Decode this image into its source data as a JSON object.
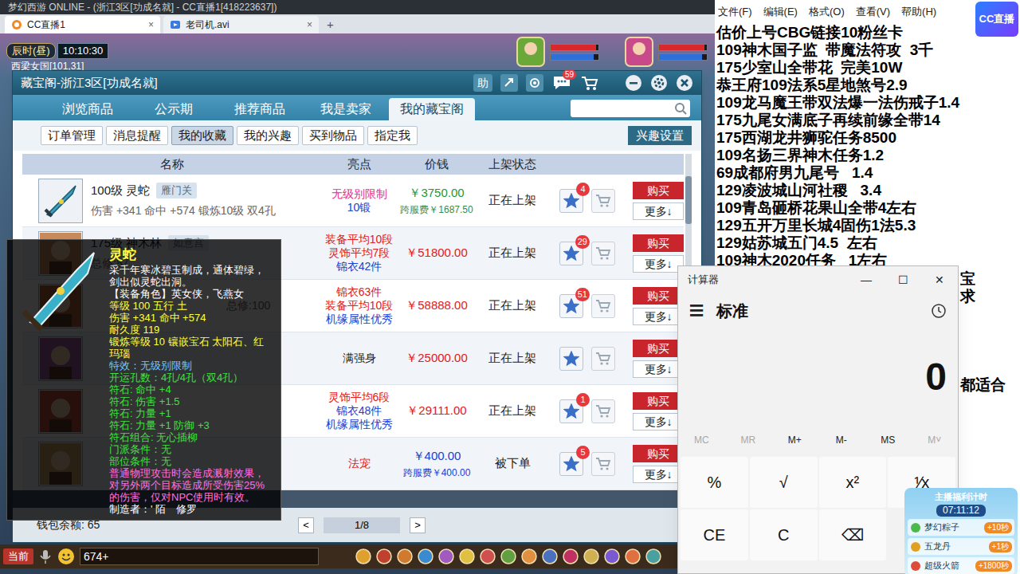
{
  "browser": {
    "title": "梦幻西游 ONLINE - (浙江3区[功成名就] - CC直播1[418223637])",
    "tabs": [
      {
        "label": "CC直播1",
        "selected": true,
        "close": "×"
      },
      {
        "label": "老司机.avi",
        "selected": false,
        "close": "×"
      }
    ],
    "new_tab": "+"
  },
  "hud": {
    "period": "辰时(昼)",
    "clock": "10:10:30",
    "location": "西梁女国[101,31]",
    "status_bars": [
      {
        "level": 0.95,
        "color": "#d8282c"
      },
      {
        "level": 0.9,
        "color": "#2f6fd8"
      },
      {
        "level": 0.95,
        "color": "#d8282c"
      },
      {
        "level": 0.9,
        "color": "#2f6fd8"
      }
    ]
  },
  "cbg": {
    "title": "藏宝阁-浙江3区[功成名就]",
    "help": "助",
    "message_badge": "59",
    "nav": [
      {
        "label": "浏览商品",
        "selected": false
      },
      {
        "label": "公示期",
        "selected": false
      },
      {
        "label": "推荐商品",
        "selected": false
      },
      {
        "label": "我是卖家",
        "selected": false
      },
      {
        "label": "我的藏宝阁",
        "selected": true
      }
    ],
    "subtabs": [
      {
        "label": "订单管理",
        "selected": false
      },
      {
        "label": "消息提醒",
        "selected": false
      },
      {
        "label": "我的收藏",
        "selected": true
      },
      {
        "label": "我的兴趣",
        "selected": false
      },
      {
        "label": "买到物品",
        "selected": false
      },
      {
        "label": "指定我",
        "selected": false
      }
    ],
    "interest_button": "兴趣设置",
    "columns": [
      "名称",
      "亮点",
      "价钱",
      "上架状态"
    ],
    "rows": [
      {
        "avatar_kind": "weapon",
        "name": "100级 灵蛇",
        "tag": "雁门关",
        "summary": "伤害 +341 命中 +574 锻炼10级 双4孔",
        "highlights": [
          {
            "text": "无级别限制",
            "color": "#e2308a"
          },
          {
            "text": "10锻",
            "color": "#2040d0"
          }
        ],
        "price": "￥3750.00",
        "price_color": "#1a9a3a",
        "fee": "跨服费￥1687.50",
        "fee_color": "#3a8a4a",
        "status": "正在上架",
        "favorites": "4",
        "favorited": true,
        "buy": "购买",
        "more": "更多↓"
      },
      {
        "avatar_kind": "character",
        "avatar_color": "#c98a5a",
        "name": "175级 神木林",
        "tag": "如意宫",
        "summary": "总修:87",
        "highlights": [
          {
            "text": "装备平均10段",
            "color": "#e02020"
          },
          {
            "text": "灵饰平均7段",
            "color": "#e02020"
          },
          {
            "text": "锦衣42件",
            "color": "#2040d0"
          }
        ],
        "price": "￥51800.00",
        "price_color": "#e02020",
        "status": "正在上架",
        "favorites": "29",
        "favorited": true,
        "buy": "购买",
        "more": "更多↓"
      },
      {
        "avatar_kind": "character",
        "avatar_color": "#b0603a",
        "summary": "总修:100",
        "highlights": [
          {
            "text": "锦衣63件",
            "color": "#e02020"
          },
          {
            "text": "装备平均10段",
            "color": "#e02020"
          },
          {
            "text": "机缘属性优秀",
            "color": "#2040d0"
          }
        ],
        "price": "￥58888.00",
        "price_color": "#e02020",
        "status": "正在上架",
        "favorites": "51",
        "favorited": true,
        "buy": "购买",
        "more": "更多↓"
      },
      {
        "avatar_kind": "character",
        "avatar_color": "#a05aa0",
        "highlights": [
          {
            "text": "满强身",
            "color": "#222222"
          }
        ],
        "price": "￥25000.00",
        "price_color": "#e02020",
        "status": "正在上架",
        "favorited": true,
        "buy": "购买",
        "more": "更多↓"
      },
      {
        "avatar_kind": "character",
        "avatar_color": "#c0503a",
        "highlights": [
          {
            "text": "灵饰平均6段",
            "color": "#e02020"
          },
          {
            "text": "锦衣48件",
            "color": "#2040d0"
          },
          {
            "text": "机缘属性优秀",
            "color": "#2040d0"
          }
        ],
        "price": "￥29111.00",
        "price_color": "#e02020",
        "status": "正在上架",
        "favorites": "1",
        "favorited": true,
        "buy": "购买",
        "more": "更多↓"
      },
      {
        "avatar_kind": "character",
        "avatar_color": "#c8a060",
        "highlights": [
          {
            "text": "法宠",
            "color": "#e02020"
          }
        ],
        "price": "￥400.00",
        "price_color": "#2040d0",
        "fee": "跨服费￥400.00",
        "fee_color": "#2040d0",
        "status": "被下单",
        "favorites": "5",
        "favorited": true,
        "buy": "购买",
        "more": "更多↓"
      }
    ],
    "pager": {
      "prev": "<",
      "page": "1/8",
      "next": ">"
    },
    "wallet": "钱包余额: 65"
  },
  "tooltip": {
    "title": "灵蛇",
    "lines": [
      {
        "text": "采千年寒冰碧玉制成，通体碧绿，剑出似灵蛇出洞。",
        "color": "#ffffff"
      },
      {
        "text": "【装备角色】英女侠，飞燕女",
        "color": "#ffffff"
      },
      {
        "text": "等级 100  五行 土",
        "color": "#ffff40"
      },
      {
        "text": "伤害 +341 命中 +574",
        "color": "#ffff40"
      },
      {
        "text": "耐久度 119",
        "color": "#ffff40"
      },
      {
        "text": "锻炼等级 10  镶嵌宝石 太阳石、红玛瑙",
        "color": "#ffff40"
      },
      {
        "text": "特效：无级别限制",
        "color": "#6ec8ff"
      },
      {
        "text": "开运孔数：4孔/4孔（双4孔）",
        "color": "#40e040"
      },
      {
        "text": "符石: 命中 +4",
        "color": "#40e040"
      },
      {
        "text": "符石: 伤害 +1.5",
        "color": "#40e040"
      },
      {
        "text": "符石: 力量 +1",
        "color": "#40e040"
      },
      {
        "text": "符石: 力量 +1 防御 +3",
        "color": "#40e040"
      },
      {
        "text": "符石组合: 无心插柳",
        "color": "#40e040"
      },
      {
        "text": "门派条件：无",
        "color": "#40e040"
      },
      {
        "text": "部位条件：无",
        "color": "#40e040"
      },
      {
        "text": "普通物理攻击时会造成溅射效果，对另外两个目标造成所受伤害25%的伤害，仅对NPC使用时有效。",
        "color": "#ff70e0"
      },
      {
        "text": "制造者：' 陌ゞ修罗",
        "color": "#ffffff"
      }
    ]
  },
  "chat": {
    "channel": "当前",
    "input": "674+"
  },
  "notepad": {
    "menu": [
      "文件(F)",
      "编辑(E)",
      "格式(O)",
      "查看(V)",
      "帮助(H)"
    ],
    "lines": [
      "估价上号CBG链接10粉丝卡",
      "109神木国子监  带魔法符攻  3千",
      "175少室山全带花  完美10W",
      "恭王府109法系5星地煞号2.9",
      "109龙马魔王带双法爆一法伤戒子1.4",
      "175九尾女满底子再续前缘全带14",
      "175西湖龙井狮驼任务8500",
      "109名扬三界神木任务1.2",
      "69成都府男九尾号   1.4",
      "129凌波城山河社稷   3.4",
      "109青岛砸桥花果山全带4左右",
      "129五开万里长城4固伤1法5.3",
      "129姑苏城五门4.5  左右",
      "109神木2020任务   1左右"
    ],
    "peek": [
      "宝",
      "求",
      "都适合"
    ]
  },
  "calculator": {
    "title": "计算器",
    "controls": [
      "—",
      "☐",
      "✕"
    ],
    "menu_icon": "☰",
    "mode": "标准",
    "display": "0",
    "memory": [
      {
        "label": "MC",
        "disabled": true
      },
      {
        "label": "MR",
        "disabled": true
      },
      {
        "label": "M+",
        "disabled": false
      },
      {
        "label": "M-",
        "disabled": false
      },
      {
        "label": "MS",
        "disabled": false
      },
      {
        "label": "M˅",
        "disabled": true
      }
    ],
    "keys": [
      "%",
      "√",
      "x²",
      "⅟x",
      "CE",
      "C",
      "⌫"
    ]
  },
  "logo": "CC直播",
  "promo": {
    "title": "主播福利计时",
    "timer": "07:11:12",
    "items": [
      {
        "name": "梦幻粽子",
        "reward": "+10秒"
      },
      {
        "name": "五龙丹",
        "reward": "+1秒"
      },
      {
        "name": "超级火箭",
        "reward": "+1800秒"
      }
    ]
  }
}
